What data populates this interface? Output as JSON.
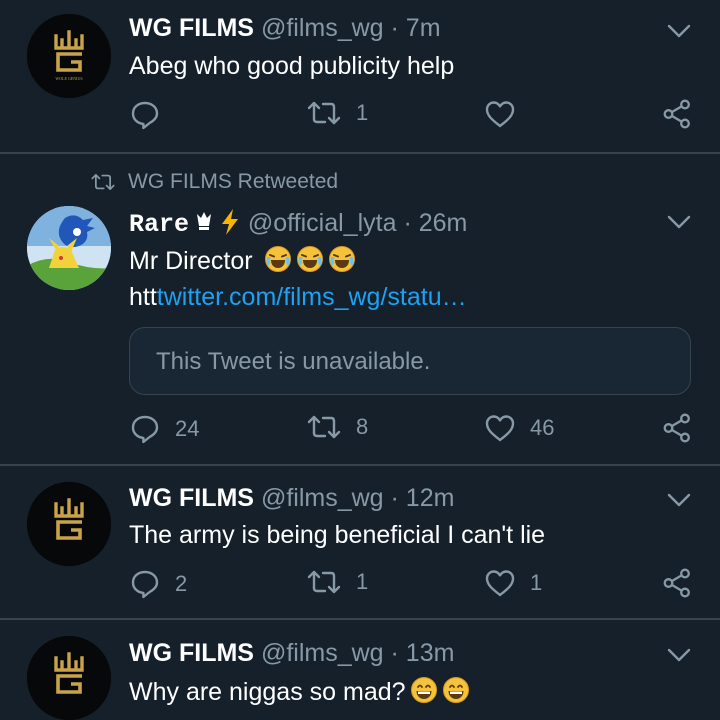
{
  "tweets": [
    {
      "name": "WG FILMS",
      "handle": "@films_wg",
      "sep": "·",
      "time": "7m",
      "text": "Abeg who good publicity help",
      "replies": "",
      "retweets": "1",
      "likes": "",
      "avatar_logo_text": "WOLE GENIUS"
    },
    {
      "retweeted_by": "WG FILMS Retweeted",
      "name": "Rare",
      "handle": "@official_lyta",
      "sep": "·",
      "time": "26m",
      "text": "Mr Director",
      "link_prefix": "htt",
      "link": "twitter.com/films_wg/statu…",
      "quoted_unavailable": "This Tweet is unavailable.",
      "replies": "24",
      "retweets": "8",
      "likes": "46"
    },
    {
      "name": "WG FILMS",
      "handle": "@films_wg",
      "sep": "·",
      "time": "12m",
      "text": "The army is being beneficial I can't lie",
      "replies": "2",
      "retweets": "1",
      "likes": "1"
    },
    {
      "name": "WG FILMS",
      "handle": "@films_wg",
      "sep": "·",
      "time": "13m",
      "text": "Why are niggas so mad?",
      "replies": "",
      "retweets": "",
      "likes": ""
    }
  ],
  "icons": {
    "reply": "reply-icon",
    "retweet": "retweet-icon",
    "like": "heart-icon",
    "share": "share-icon",
    "caret": "chevron-down-icon"
  },
  "colors": {
    "background": "#15202b",
    "secondary_text": "#8899a6",
    "link": "#1da1f2",
    "divider": "#38444d",
    "logo_gold": "#c9a24a"
  }
}
